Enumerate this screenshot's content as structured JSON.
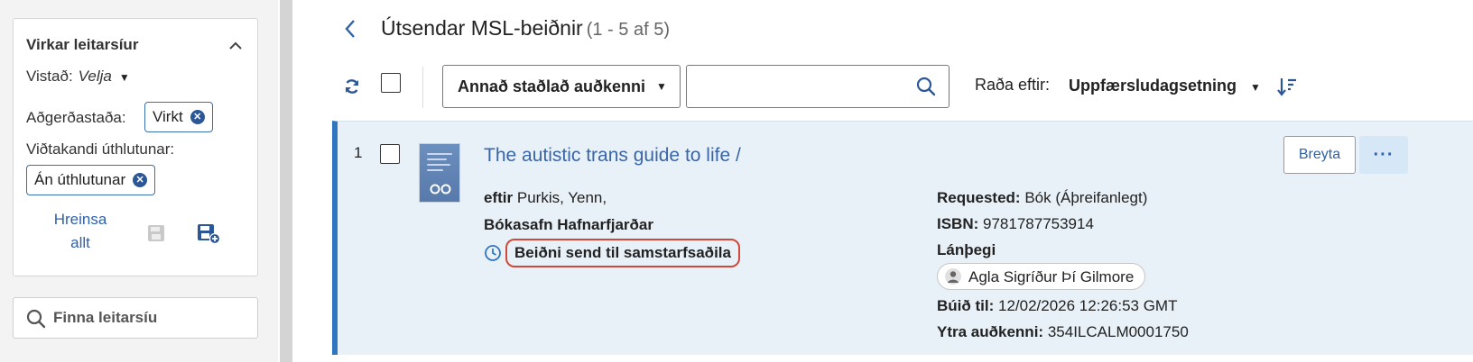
{
  "filters": {
    "title": "Virkar leitarsíur",
    "location": {
      "label": "Vistað:",
      "value": "Velja"
    },
    "status": {
      "label": "Aðgerðastaða:",
      "chip": "Virkt"
    },
    "assignee": {
      "label": "Viðtakandi úthlutunar:",
      "chip": "Án úthlutunar"
    },
    "clear_all": "Hreinsa allt",
    "find_placeholder": "Finna leitarsíu"
  },
  "header": {
    "title": "Útsendar MSL-beiðnir",
    "count": "(1 - 5 af 5)"
  },
  "toolbar": {
    "identifier_select": "Annað staðlað auðkenni",
    "search_value": "",
    "sort_label": "Raða eftir:",
    "sort_value": "Uppfærsludagsetning"
  },
  "result": {
    "index": "1",
    "title": "The autistic trans guide to life /",
    "author_prefix": "eftir",
    "author": "Purkis, Yenn,",
    "library": "Bókasafn Hafnarfjarðar",
    "status": "Beiðni send til samstarfsaðila",
    "requested_label": "Requested:",
    "requested_value": "Bók (Áþreifanlegt)",
    "isbn_label": "ISBN:",
    "isbn_value": "9781787753914",
    "borrower_label": "Lánþegi",
    "borrower_name": "Agla Sigríður Þí Gilmore",
    "created_label": "Búið til:",
    "created_value": "12/02/2026 12:26:53 GMT",
    "external_label": "Ytra auðkenni:",
    "external_value": "354ILCALM0001750",
    "edit_label": "Breyta",
    "more_label": "···"
  },
  "colors": {
    "accent": "#2f75c0",
    "link": "#3a66a6",
    "status_highlight": "#d0493a",
    "row_background": "#e9f1f8"
  },
  "icons": [
    "chevron-up-icon",
    "save-icon",
    "save-plus-icon",
    "search-icon",
    "chevron-left-icon",
    "refresh-icon",
    "sort-descending-icon",
    "clock-icon",
    "user-icon"
  ]
}
